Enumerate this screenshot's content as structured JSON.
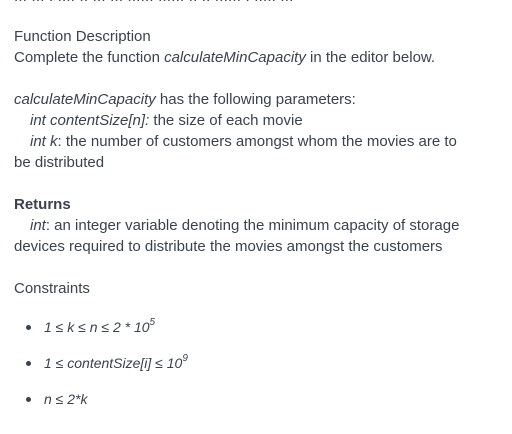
{
  "clipped_top_text": "... ... . .... .. ... ... ...... ...... .. .. ...... . ..... ...",
  "function_description": {
    "heading": "Function Description",
    "sentence_prefix": "Complete the function ",
    "function_name": "calculateMinCapacity",
    "sentence_suffix": " in the editor below."
  },
  "parameters": {
    "function_name": "calculateMinCapacity",
    "intro_suffix": " has the following parameters:",
    "items": [
      {
        "signature": "int contentSize[n]:",
        "description": "  the size of each movie"
      },
      {
        "signature": "int k",
        "description": ": the number of customers amongst whom the movies are to"
      }
    ],
    "wrap_line": "be distributed"
  },
  "returns": {
    "heading": "Returns",
    "type": "int",
    "description": ": an integer variable denoting the minimum capacity of storage",
    "wrap_line": "devices required to distribute the movies amongst the customers"
  },
  "constraints": {
    "heading": "Constraints",
    "items": [
      {
        "text": "1 ≤ k ≤ n ≤ 2 * 10",
        "sup": "5"
      },
      {
        "text": "1 ≤ contentSize[i] ≤ 10",
        "sup": "9"
      },
      {
        "text": "n ≤ 2*k",
        "sup": ""
      }
    ]
  }
}
